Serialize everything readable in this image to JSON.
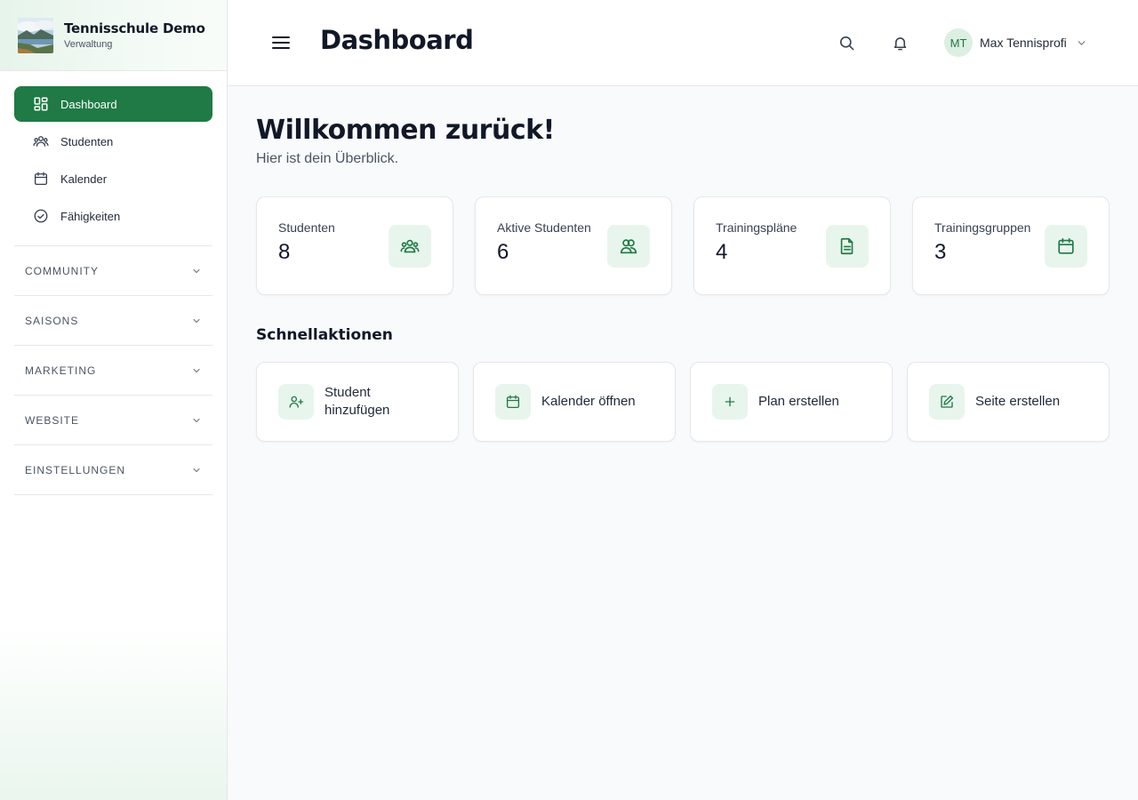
{
  "brand": {
    "title": "Tennisschule Demo",
    "subtitle": "Verwaltung"
  },
  "sidebar": {
    "items": [
      {
        "label": "Dashboard",
        "icon": "dashboard-icon",
        "active": true
      },
      {
        "label": "Studenten",
        "icon": "users-icon"
      },
      {
        "label": "Kalender",
        "icon": "calendar-icon"
      },
      {
        "label": "Fähigkeiten",
        "icon": "check-circle-icon"
      }
    ],
    "sections": [
      "COMMUNITY",
      "SAISONS",
      "MARKETING",
      "WEBSITE",
      "EINSTELLUNGEN"
    ]
  },
  "header": {
    "title": "Dashboard",
    "user": {
      "initials": "MT",
      "name": "Max Tennisprofi"
    }
  },
  "main": {
    "welcome": "Willkommen zurück!",
    "welcome_sub": "Hier ist dein Überblick.",
    "stats": [
      {
        "label": "Studenten",
        "value": "8",
        "icon": "users-group-icon"
      },
      {
        "label": "Aktive Studenten",
        "value": "6",
        "icon": "users-active-icon"
      },
      {
        "label": "Trainingspläne",
        "value": "4",
        "icon": "document-icon"
      },
      {
        "label": "Trainingsgruppen",
        "value": "3",
        "icon": "calendar-icon"
      }
    ],
    "quick_actions_title": "Schnellaktionen",
    "quick_actions": [
      {
        "label_line1": "Student",
        "label_line2": "hinzufügen",
        "icon": "user-plus-icon"
      },
      {
        "label_line1": "Kalender öffnen",
        "label_line2": "",
        "icon": "calendar-icon"
      },
      {
        "label_line1": "Plan erstellen",
        "label_line2": "",
        "icon": "plus-icon"
      },
      {
        "label_line1": "Seite erstellen",
        "label_line2": "",
        "icon": "edit-icon"
      }
    ]
  },
  "colors": {
    "accent": "#1f7a45",
    "accent_light": "#e8f5ec",
    "background": "#f8fafb"
  }
}
